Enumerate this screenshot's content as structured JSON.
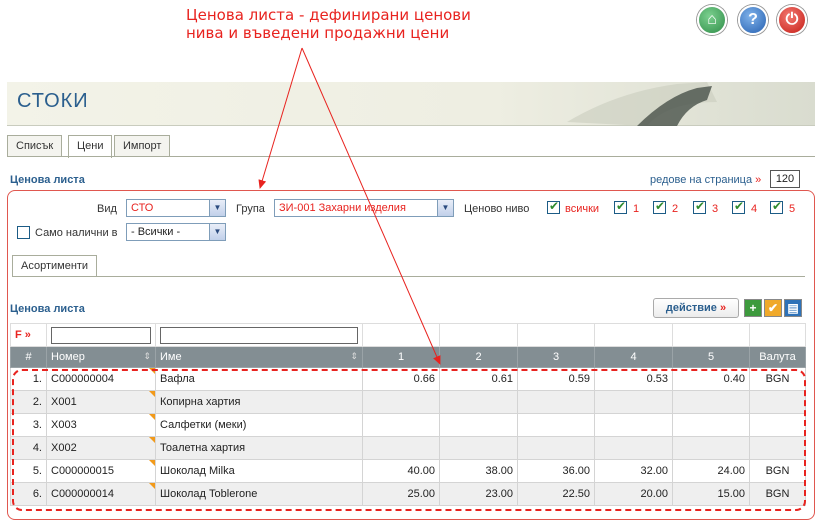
{
  "annotation": {
    "line1": "Ценова листа - дефинирани ценови",
    "line2": "нива и въведени продажни цени"
  },
  "header": {
    "title": "СТОКИ"
  },
  "tabs": [
    {
      "label": "Списък"
    },
    {
      "label": "Цени"
    },
    {
      "label": "Импорт"
    }
  ],
  "section": {
    "title": "Ценова листа",
    "rows_label": "редове на страница",
    "rows_value": "120"
  },
  "filters": {
    "type_label": "Вид",
    "type_value": "СТО",
    "group_label": "Група",
    "group_value": "ЗИ-001 Захарни изделия",
    "price_level_label": "Ценово ниво",
    "levels": [
      "всички",
      "1",
      "2",
      "3",
      "4",
      "5"
    ],
    "only_available_label": "Само налични в",
    "only_available_value": "- Всички -"
  },
  "subtab": {
    "label": "Асортименти"
  },
  "list": {
    "title": "Ценова листа",
    "action_label": "действие",
    "filter_tag": "F"
  },
  "table": {
    "headers": [
      "#",
      "Номер",
      "Име",
      "1",
      "2",
      "3",
      "4",
      "5",
      "Валута"
    ],
    "rows": [
      {
        "n": "1.",
        "num": "C000000004",
        "name": "Вафла",
        "p1": "0.66",
        "p2": "0.61",
        "p3": "0.59",
        "p4": "0.53",
        "p5": "0.40",
        "cur": "BGN"
      },
      {
        "n": "2.",
        "num": "X001",
        "name": "Копирна хартия",
        "p1": "",
        "p2": "",
        "p3": "",
        "p4": "",
        "p5": "",
        "cur": ""
      },
      {
        "n": "3.",
        "num": "X003",
        "name": "Салфетки (меки)",
        "p1": "",
        "p2": "",
        "p3": "",
        "p4": "",
        "p5": "",
        "cur": ""
      },
      {
        "n": "4.",
        "num": "X002",
        "name": "Тоалетна хартия",
        "p1": "",
        "p2": "",
        "p3": "",
        "p4": "",
        "p5": "",
        "cur": ""
      },
      {
        "n": "5.",
        "num": "C000000015",
        "name": "Шоколад Milka",
        "p1": "40.00",
        "p2": "38.00",
        "p3": "36.00",
        "p4": "32.00",
        "p5": "24.00",
        "cur": "BGN"
      },
      {
        "n": "6.",
        "num": "C000000014",
        "name": "Шоколад Toblerone",
        "p1": "25.00",
        "p2": "23.00",
        "p3": "22.50",
        "p4": "20.00",
        "p5": "15.00",
        "cur": "BGN"
      }
    ]
  },
  "icons": {
    "home": "home-icon",
    "help": "help-icon",
    "power": "power-icon",
    "add": "plus-icon",
    "check": "check-icon",
    "print": "print-icon"
  },
  "colors": {
    "accent": "#2b5f8e",
    "annotation": "#e8231f",
    "table_header": "#838e93"
  }
}
